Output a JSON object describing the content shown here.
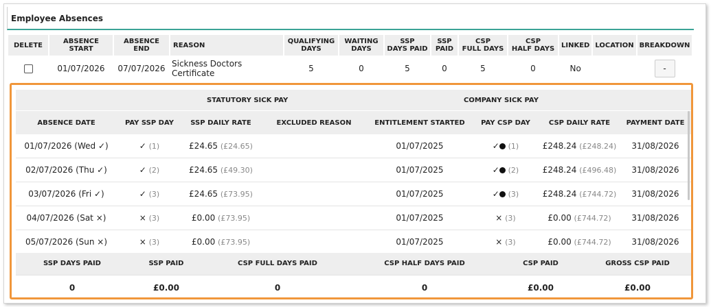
{
  "section": {
    "title": "Employee Absences"
  },
  "absences_table": {
    "headers": {
      "delete": "DELETE",
      "absence_start": "ABSENCE START",
      "absence_end": "ABSENCE END",
      "reason": "REASON",
      "qualifying_days_1": "QUALIFYING",
      "qualifying_days_2": "DAYS",
      "waiting_days_1": "WAITING",
      "waiting_days_2": "DAYS",
      "ssp_days_paid_1": "SSP",
      "ssp_days_paid_2": "DAYS PAID",
      "ssp_paid_1": "SSP",
      "ssp_paid_2": "PAID",
      "csp_full_days_1": "CSP",
      "csp_full_days_2": "FULL DAYS",
      "csp_half_days_1": "CSP",
      "csp_half_days_2": "HALF DAYS",
      "linked": "LINKED",
      "location": "LOCATION",
      "breakdown": "BREAKDOWN"
    },
    "row": {
      "absence_start": "01/07/2026",
      "absence_end": "07/07/2026",
      "reason": "Sickness Doctors Certificate",
      "qualifying_days": "5",
      "waiting_days": "0",
      "ssp_days_paid": "5",
      "ssp_paid": "0",
      "csp_full_days": "5",
      "csp_half_days": "0",
      "linked": "No",
      "location": "",
      "breakdown_button": "-"
    }
  },
  "breakdown": {
    "groups": {
      "ssp": "STATUTORY SICK PAY",
      "csp": "COMPANY SICK PAY"
    },
    "headers": {
      "absence_date": "ABSENCE DATE",
      "pay_ssp_day": "PAY SSP DAY",
      "ssp_daily_rate": "SSP DAILY RATE",
      "excluded_reason": "EXCLUDED REASON",
      "entitlement_started": "ENTITLEMENT STARTED",
      "pay_csp_day": "PAY CSP DAY",
      "csp_daily_rate": "CSP DAILY RATE",
      "payment_date": "PAYMENT DATE"
    },
    "rows": [
      {
        "date": "01/07/2026 (Wed ✓)",
        "ssp_mark": "✓",
        "ssp_count": "(1)",
        "ssp_rate": "£24.65",
        "ssp_cum": "(£24.65)",
        "excluded": "",
        "entitlement": "01/07/2025",
        "csp_mark": "✓",
        "csp_count": "(1)",
        "csp_rate": "£248.24",
        "csp_cum": "(£248.24)",
        "payment": "31/08/2026"
      },
      {
        "date": "02/07/2026 (Thu ✓)",
        "ssp_mark": "✓",
        "ssp_count": "(2)",
        "ssp_rate": "£24.65",
        "ssp_cum": "(£49.30)",
        "excluded": "",
        "entitlement": "01/07/2025",
        "csp_mark": "✓",
        "csp_count": "(2)",
        "csp_rate": "£248.24",
        "csp_cum": "(£496.48)",
        "payment": "31/08/2026"
      },
      {
        "date": "03/07/2026 (Fri ✓)",
        "ssp_mark": "✓",
        "ssp_count": "(3)",
        "ssp_rate": "£24.65",
        "ssp_cum": "(£73.95)",
        "excluded": "",
        "entitlement": "01/07/2025",
        "csp_mark": "✓",
        "csp_count": "(3)",
        "csp_rate": "£248.24",
        "csp_cum": "(£744.72)",
        "payment": "31/08/2026"
      },
      {
        "date": "04/07/2026 (Sat ×)",
        "ssp_mark": "×",
        "ssp_count": "(3)",
        "ssp_rate": "£0.00",
        "ssp_cum": "(£73.95)",
        "excluded": "",
        "entitlement": "01/07/2025",
        "csp_mark": "×",
        "csp_count": "(3)",
        "csp_rate": "£0.00",
        "csp_cum": "(£744.72)",
        "payment": "31/08/2026"
      },
      {
        "date": "05/07/2026 (Sun ×)",
        "ssp_mark": "×",
        "ssp_count": "(3)",
        "ssp_rate": "£0.00",
        "ssp_cum": "(£73.95)",
        "excluded": "",
        "entitlement": "01/07/2025",
        "csp_mark": "×",
        "csp_count": "(3)",
        "csp_rate": "£0.00",
        "csp_cum": "(£744.72)",
        "payment": "31/08/2026"
      }
    ],
    "totals": {
      "headers": {
        "ssp_days_paid": "SSP DAYS PAID",
        "ssp_paid": "SSP PAID",
        "csp_full_days_paid": "CSP FULL DAYS PAID",
        "csp_half_days_paid": "CSP HALF DAYS PAID",
        "csp_paid": "CSP PAID",
        "gross_csp_paid": "GROSS CSP PAID"
      },
      "values": {
        "ssp_days_paid": "0",
        "ssp_paid": "£0.00",
        "csp_full_days_paid": "0",
        "csp_half_days_paid": "0",
        "csp_paid": "£0.00",
        "gross_csp_paid": "£0.00"
      }
    }
  },
  "colors": {
    "accent_teal": "#3aa396",
    "highlight_orange": "#f0963a",
    "header_bg": "#eeeeee"
  }
}
